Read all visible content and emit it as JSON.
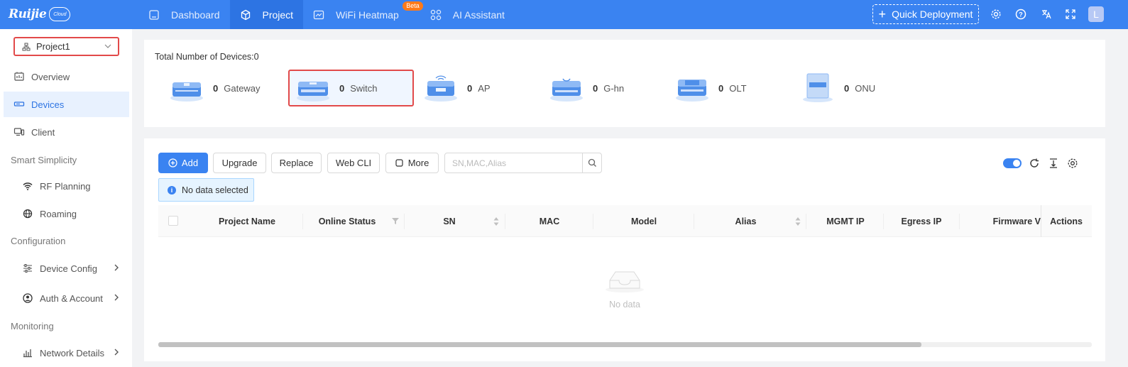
{
  "brand": {
    "logo_text": "Ruijie",
    "cloud_text": "Cloud"
  },
  "nav": [
    {
      "label": "Dashboard",
      "icon": "home-icon"
    },
    {
      "label": "Project",
      "icon": "cube-icon"
    },
    {
      "label": "WiFi Heatmap",
      "icon": "heatmap-icon",
      "badge": "Beta"
    },
    {
      "label": "AI Assistant",
      "icon": "grid-icon"
    }
  ],
  "header": {
    "quick_deploy": "Quick Deployment",
    "avatar": "L"
  },
  "sidebar": {
    "project": "Project1",
    "items": [
      {
        "label": "Overview"
      },
      {
        "label": "Devices"
      },
      {
        "label": "Client"
      }
    ],
    "groups": {
      "smart": "Smart Simplicity",
      "config": "Configuration",
      "monitor": "Monitoring"
    },
    "smart_items": [
      {
        "label": "RF Planning"
      },
      {
        "label": "Roaming"
      }
    ],
    "config_items": [
      {
        "label": "Device Config"
      },
      {
        "label": "Auth & Account"
      }
    ],
    "monitor_items": [
      {
        "label": "Network Details"
      }
    ]
  },
  "summary": {
    "total_label": "Total Number of Devices:0",
    "devices": [
      {
        "count": "0",
        "label": "Gateway"
      },
      {
        "count": "0",
        "label": "Switch"
      },
      {
        "count": "0",
        "label": "AP"
      },
      {
        "count": "0",
        "label": "G-hn"
      },
      {
        "count": "0",
        "label": "OLT"
      },
      {
        "count": "0",
        "label": "ONU"
      }
    ]
  },
  "toolbar": {
    "add": "Add",
    "upgrade": "Upgrade",
    "replace": "Replace",
    "webcli": "Web CLI",
    "more": "More",
    "search_placeholder": "SN,MAC,Alias"
  },
  "selection": {
    "text": "No data selected"
  },
  "table": {
    "columns": [
      "Project Name",
      "Online Status",
      "SN",
      "MAC",
      "Model",
      "Alias",
      "MGMT IP",
      "Egress IP",
      "Firmware V",
      "Actions"
    ],
    "empty_text": "No data"
  },
  "colors": {
    "primary": "#3a83f1",
    "highlight": "#e24a4a",
    "orange_badge": "#ff7a1a"
  }
}
